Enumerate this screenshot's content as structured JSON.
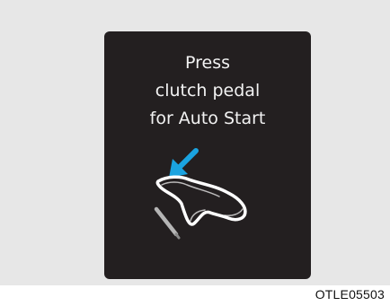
{
  "display": {
    "message_lines": [
      "Press",
      "clutch pedal",
      "for Auto Start"
    ],
    "icon": "pedal-press-icon"
  },
  "figure_code": "OTLE05503",
  "colors": {
    "background": "#e7e7e7",
    "display": "#231f20",
    "text": "#f2f2f2",
    "arrow": "#1aa3e0"
  }
}
